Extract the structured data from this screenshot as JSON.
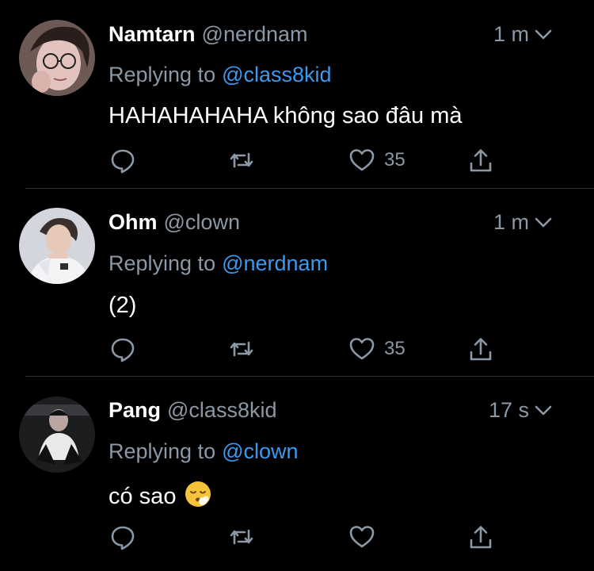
{
  "tweets": [
    {
      "name": "Namtarn",
      "handle": "@nerdnam",
      "time": "1 m",
      "replying_prefix": "Replying to",
      "replying_to": "@class8kid",
      "text": "HAHAHAHAHA không sao đâu mà",
      "likes": "35",
      "avatar_color": "#c9a9a6"
    },
    {
      "name": "Ohm",
      "handle": "@clown",
      "time": "1 m",
      "replying_prefix": "Replying to",
      "replying_to": "@nerdnam",
      "text": "(2)",
      "likes": "35",
      "avatar_color": "#c9cbd0"
    },
    {
      "name": "Pang",
      "handle": "@class8kid",
      "time": "17 s",
      "replying_prefix": "Replying to",
      "replying_to": "@clown",
      "text": "có sao",
      "likes": "",
      "avatar_color": "#2a2a2a",
      "emoji": "face-exhaling-emoji"
    }
  ],
  "colors": {
    "background": "#000000",
    "secondary_text": "#8b98a5",
    "mention": "#3b9aee",
    "divider": "#2f3336"
  },
  "icons": [
    "reply-icon",
    "retweet-icon",
    "like-icon",
    "share-icon",
    "chevron-down-icon"
  ]
}
